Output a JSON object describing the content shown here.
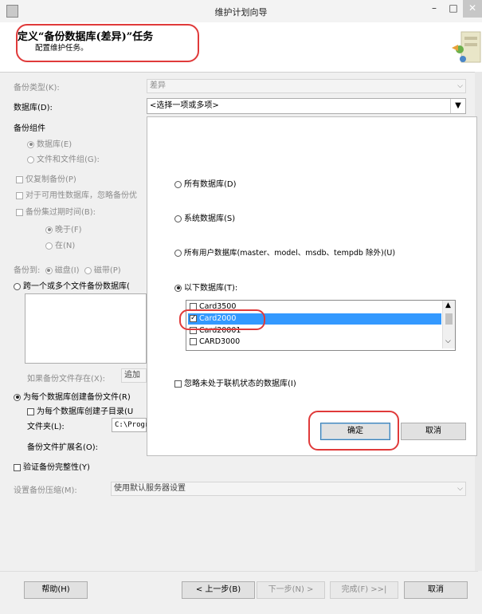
{
  "window": {
    "title": "维护计划向导",
    "min_glyph": "–",
    "max_glyph": "□",
    "close_glyph": "✕"
  },
  "header": {
    "title": "定义“备份数据库(差异)”任务",
    "subtitle": "配置维护任务。"
  },
  "form": {
    "backup_type_label": "备份类型(K):",
    "backup_type_value": "差异",
    "database_label": "数据库(D):",
    "database_value": "<选择一项或多项>",
    "backup_component_label": "备份组件",
    "component_database": "数据库(E)",
    "component_files": "文件和文件组(G):",
    "copy_only": "仅复制备份(P)",
    "availability": "对于可用性数据库，忽略备份优",
    "expire_label": "备份集过期时间(B):",
    "expire_after": "晚于(F)",
    "expire_on": "在(N)",
    "backup_to_label": "备份到:",
    "backup_to_disk": "磁盘(I)",
    "backup_to_tape": "磁带(P)",
    "span_files": "跨一个或多个文件备份数据库(",
    "if_exists_label": "如果备份文件存在(X):",
    "if_exists_value": "追加",
    "create_per_db": "为每个数据库创建备份文件(R)",
    "create_subdir": "为每个数据库创建子目录(U",
    "folder_label": "文件夹(L):",
    "folder_value": "C:\\Progr",
    "extension_label": "备份文件扩展名(O):",
    "verify": "验证备份完整性(Y)",
    "compression_label": "设置备份压缩(M):",
    "compression_value": "使用默认服务器设置"
  },
  "popup": {
    "all_db": "所有数据库(D)",
    "system_db": "系统数据库(S)",
    "user_db": "所有用户数据库(master、model、msdb、tempdb 除外)(U)",
    "these_db": "以下数据库(T):",
    "list": [
      {
        "name": "Card3500",
        "checked": false,
        "selected": false
      },
      {
        "name": "Card2000",
        "checked": true,
        "selected": true
      },
      {
        "name": "Card20001",
        "checked": false,
        "selected": false
      },
      {
        "name": "CARD3000",
        "checked": false,
        "selected": false
      }
    ],
    "ignore_offline": "忽略未处于联机状态的数据库(I)",
    "ok": "确定",
    "cancel": "取消"
  },
  "footer": {
    "help": "帮助(H)",
    "back": "< 上一步(B)",
    "next": "下一步(N) >",
    "finish": "完成(F) >>|",
    "cancel": "取消"
  },
  "colors": {
    "highlight": "#3399ff",
    "annotation_red": "#e03a3a",
    "button_border": "#3c7fb1"
  }
}
